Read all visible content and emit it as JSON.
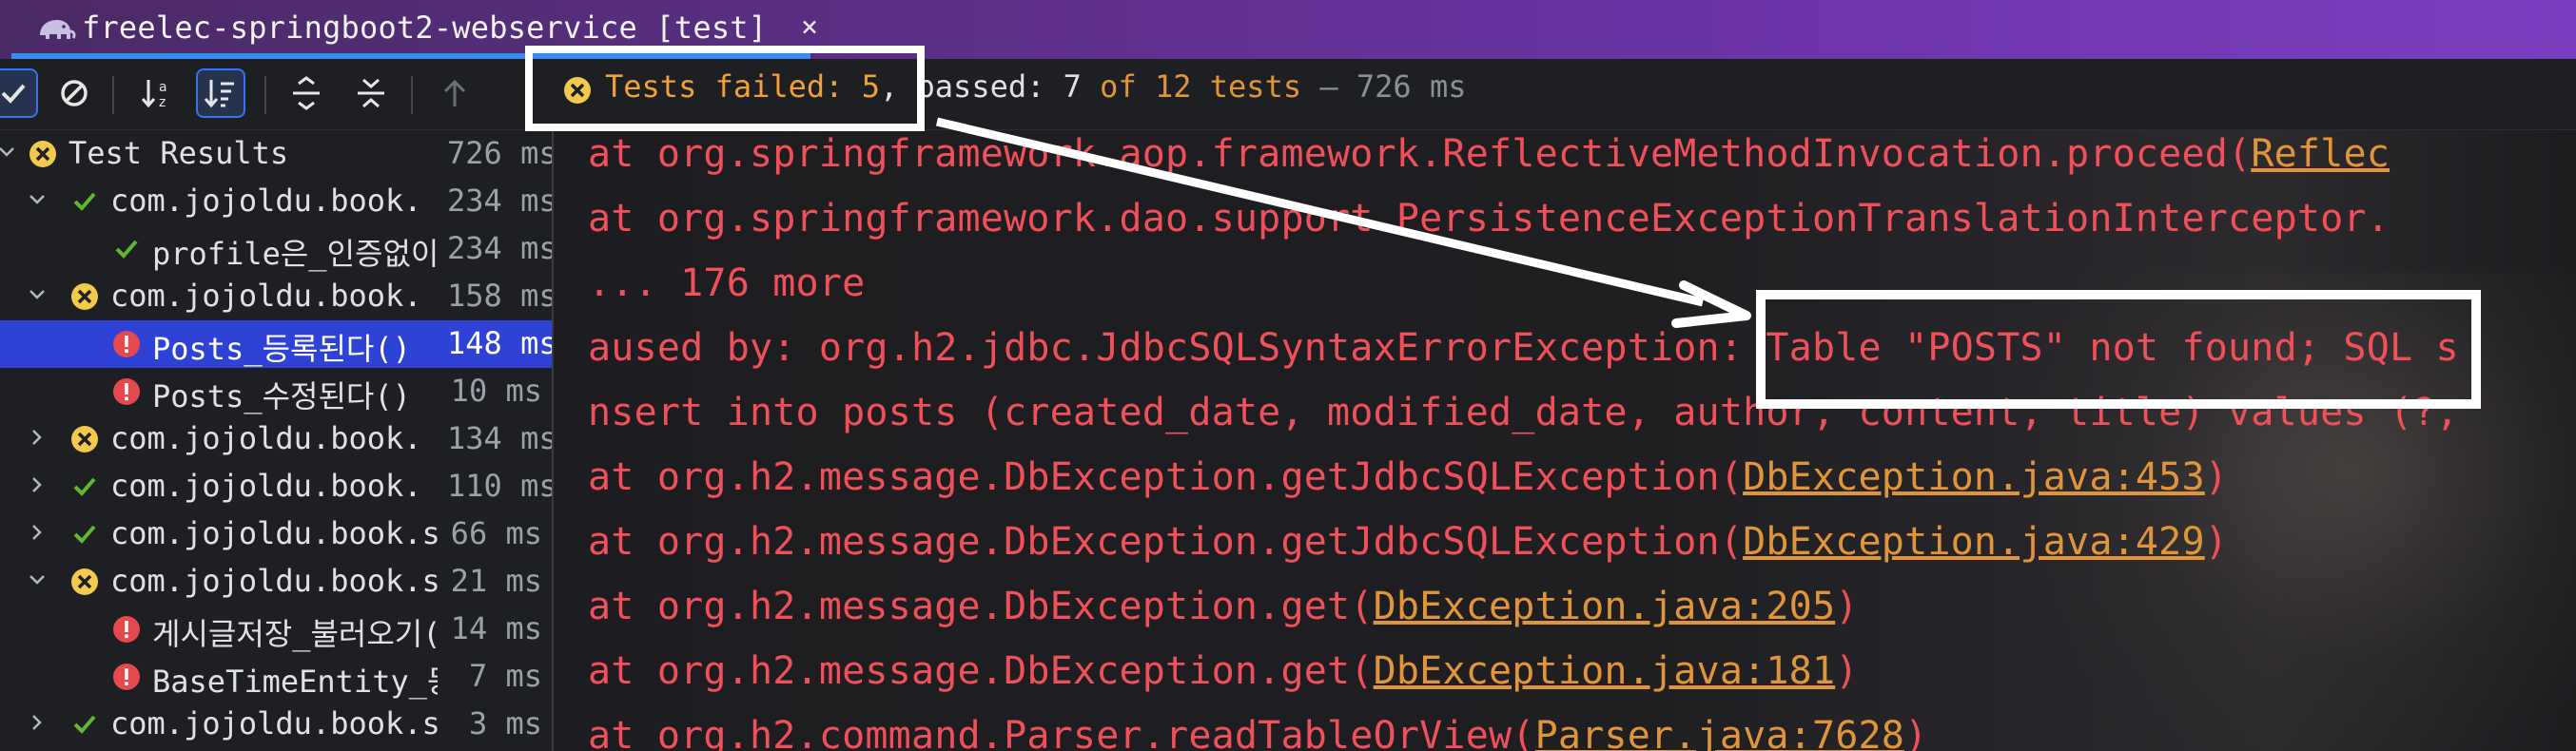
{
  "window": {
    "tab_title": "freelec-springboot2-webservice [test]",
    "close_glyph": "×",
    "tab_icon": "gradle-elephant-icon"
  },
  "toolbar": {
    "buttons": [
      "check-icon",
      "stop-icon",
      "sort-alpha-icon",
      "sort-duration-icon",
      "expand-all-icon",
      "collapse-all-icon",
      "up-arrow-icon"
    ]
  },
  "status": {
    "failed": "Tests failed: 5",
    "comma": ",",
    "passed": " passed: 7",
    "of": " of 12 tests",
    "ms": " – 726 ms"
  },
  "tree": {
    "rows": [
      {
        "label": "Test Results",
        "time": "726 ms",
        "status": "fail",
        "chevron": "down",
        "indent": 0
      },
      {
        "label": "com.jojoldu.book.",
        "time": "234 ms",
        "status": "pass",
        "chevron": "down",
        "indent": 1
      },
      {
        "label": "profile은_인증없이",
        "time": "234 ms",
        "status": "pass",
        "chevron": "",
        "indent": 2
      },
      {
        "label": "com.jojoldu.book.",
        "time": "158 ms",
        "status": "fail",
        "chevron": "down",
        "indent": 1
      },
      {
        "label": "Posts_등록된다()",
        "time": "148 ms",
        "status": "error",
        "chevron": "",
        "indent": 2,
        "selected": true
      },
      {
        "label": "Posts_수정된다()",
        "time": "10 ms",
        "status": "error",
        "chevron": "",
        "indent": 2
      },
      {
        "label": "com.jojoldu.book.",
        "time": "134 ms",
        "status": "fail",
        "chevron": "right",
        "indent": 1
      },
      {
        "label": "com.jojoldu.book.",
        "time": "110 ms",
        "status": "pass",
        "chevron": "right",
        "indent": 1
      },
      {
        "label": "com.jojoldu.book.s",
        "time": "66 ms",
        "status": "pass",
        "chevron": "right",
        "indent": 1
      },
      {
        "label": "com.jojoldu.book.s",
        "time": "21 ms",
        "status": "fail",
        "chevron": "down",
        "indent": 1
      },
      {
        "label": "게시글저장_불러오기()",
        "time": "14 ms",
        "status": "error",
        "chevron": "",
        "indent": 2
      },
      {
        "label": "BaseTimeEntity_등",
        "time": "7 ms",
        "status": "error",
        "chevron": "",
        "indent": 2
      },
      {
        "label": "com.jojoldu.book.sp",
        "time": "3 ms",
        "status": "pass",
        "chevron": "right",
        "indent": 1
      }
    ]
  },
  "console": {
    "lines": [
      {
        "pre": "   at org.springframework.aop.framework.ReflectiveMethodInvocation.proceed(",
        "link": "Reflec",
        "post": ""
      },
      {
        "pre": "   at org.springframework.dao.support.PersistenceExceptionTranslationInterceptor.",
        "link": "",
        "post": ""
      },
      {
        "pre": "   ... 176 more",
        "link": "",
        "post": ""
      },
      {
        "pre": "aused by: org.h2.jdbc.JdbcSQLSyntaxErrorException: Table \"POSTS\" not found; SQL s",
        "link": "",
        "post": ""
      },
      {
        "pre": "nsert into posts (created_date, modified_date, author, content, title) values (?,",
        "link": "",
        "post": ""
      },
      {
        "pre": "   at org.h2.message.DbException.getJdbcSQLException(",
        "link": "DbException.java:453",
        "post": ")"
      },
      {
        "pre": "   at org.h2.message.DbException.getJdbcSQLException(",
        "link": "DbException.java:429",
        "post": ")"
      },
      {
        "pre": "   at org.h2.message.DbException.get(",
        "link": "DbException.java:205",
        "post": ")"
      },
      {
        "pre": "   at org.h2.message.DbException.get(",
        "link": "DbException.java:181",
        "post": ")"
      },
      {
        "pre": "   at org.h2.command.Parser.readTableOrView(",
        "link": "Parser.java:7628",
        "post": ")"
      }
    ]
  },
  "colors": {
    "error_red": "#f0505a",
    "link_orange": "#e0953a",
    "pass_green": "#5fb832",
    "fail_yellow": "#f2c94c",
    "selection": "#2e43d6"
  }
}
